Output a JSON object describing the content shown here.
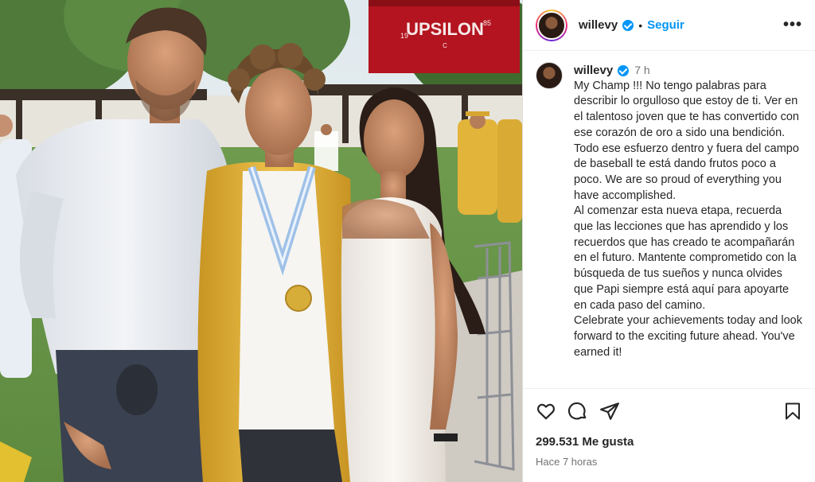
{
  "post": {
    "username": "willevy",
    "follow_label": "Seguir",
    "more_label": "•••",
    "dot": "•",
    "time_relative": "7 h",
    "caption": "My Champ !!! No tengo palabras para describir lo orgulloso que estoy de ti. Ver en el talentoso joven que te has convertido con ese corazón de oro a sido una bendición. Todo ese esfuerzo dentro y fuera del campo de baseball te está dando frutos poco a poco. We are so proud of everything you have accomplished.\nAl comenzar esta nueva etapa, recuerda que las lecciones que has aprendido y los recuerdos que has creado te acompañarán en el futuro. Mantente comprometido con la búsqueda de tus sueños y nunca olvides que Papi siempre está aquí para apoyarte en cada paso del camino.\nCelebrate your achievements today and look forward to the exciting future ahead. You've earned it!",
    "likes": "299.531 Me gusta",
    "posted": "Hace 7 horas"
  },
  "photo": {
    "sign_title": "UPSILON",
    "sign_left": "19",
    "sign_right": "85",
    "sign_sub": "C"
  },
  "icons": [
    "heart-icon",
    "comment-icon",
    "share-icon",
    "bookmark-icon",
    "verified-icon",
    "more-icon"
  ],
  "colors": {
    "accent": "#0095f6",
    "text": "#262626",
    "muted": "#737373",
    "sign": "#b3141f",
    "gown": "#e2b43a"
  }
}
